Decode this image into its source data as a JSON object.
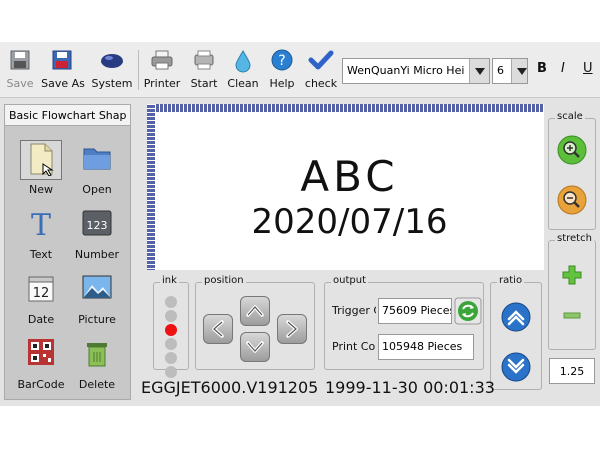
{
  "toolbar": {
    "save": "Save",
    "save_as": "Save As",
    "system": "System",
    "printer": "Printer",
    "start": "Start",
    "clean": "Clean",
    "help": "Help",
    "check": "check",
    "font": "WenQuanYi Micro Hei",
    "size": "6",
    "bold": "B",
    "italic": "I",
    "underline": "U"
  },
  "palette": {
    "tab": "Basic Flowchart Shap",
    "items": [
      "New",
      "Open",
      "Text",
      "Number",
      "Date",
      "Picture",
      "BarCode",
      "Delete"
    ],
    "number_icon_text": "123",
    "date_icon_text": "12"
  },
  "canvas": {
    "line1": "ABC",
    "line2": "2020/07/16"
  },
  "side": {
    "scale": "scale",
    "stretch": "stretch",
    "value": "1.25"
  },
  "bottom": {
    "ink": "ink",
    "ink_active_index": 2,
    "position": "position",
    "output": "output",
    "trigger_label": "Trigger C",
    "trigger_value": "75609  Pieces",
    "print_label": "Print Cou",
    "print_value": "105948  Pieces",
    "ratio": "ratio"
  },
  "status": {
    "version": "EGGJET6000.V191205",
    "datetime": "1999-11-30 00:01:33"
  },
  "colors": {
    "canvas_frame": "#6b78b5",
    "help_blue": "#2a7fd0",
    "scale_green": "#5bbf3a",
    "ink_active": "#ee1111"
  }
}
